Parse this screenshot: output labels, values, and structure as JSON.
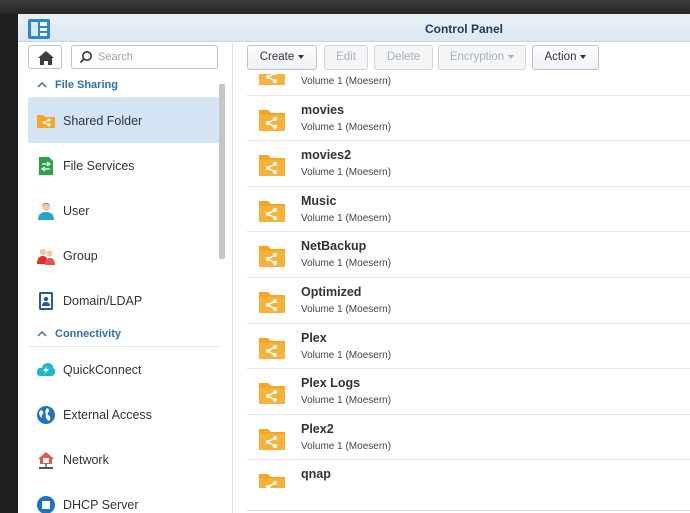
{
  "window": {
    "title": "Control Panel"
  },
  "search": {
    "placeholder": "Search"
  },
  "sidebar": {
    "sections": [
      {
        "label": "File Sharing"
      },
      {
        "label": "Connectivity"
      }
    ],
    "items": [
      {
        "label": "Shared Folder",
        "icon": "shared-folder-icon"
      },
      {
        "label": "File Services",
        "icon": "file-services-icon"
      },
      {
        "label": "User",
        "icon": "user-icon"
      },
      {
        "label": "Group",
        "icon": "group-icon"
      },
      {
        "label": "Domain/LDAP",
        "icon": "domain-ldap-icon"
      },
      {
        "label": "QuickConnect",
        "icon": "quickconnect-icon"
      },
      {
        "label": "External Access",
        "icon": "external-access-icon"
      },
      {
        "label": "Network",
        "icon": "network-icon"
      },
      {
        "label": "DHCP Server",
        "icon": "dhcp-server-icon"
      }
    ]
  },
  "toolbar": {
    "create": "Create",
    "edit": "Edit",
    "delete": "Delete",
    "encryption": "Encryption",
    "action": "Action"
  },
  "folders": [
    {
      "name": "",
      "location": "Volume 1 (Moesern)"
    },
    {
      "name": "movies",
      "location": "Volume 1 (Moesern)"
    },
    {
      "name": "movies2",
      "location": "Volume 1 (Moesern)"
    },
    {
      "name": "Music",
      "location": "Volume 1 (Moesern)"
    },
    {
      "name": "NetBackup",
      "location": "Volume 1 (Moesern)"
    },
    {
      "name": "Optimized",
      "location": "Volume 1 (Moesern)"
    },
    {
      "name": "Plex",
      "location": "Volume 1 (Moesern)"
    },
    {
      "name": "Plex Logs",
      "location": "Volume 1 (Moesern)"
    },
    {
      "name": "Plex2",
      "location": "Volume 1 (Moesern)"
    },
    {
      "name": "qnap",
      "location": ""
    }
  ],
  "colors": {
    "accent": "#2f6fb0",
    "folder": "#f5a623",
    "selected": "#d3e4f5"
  }
}
